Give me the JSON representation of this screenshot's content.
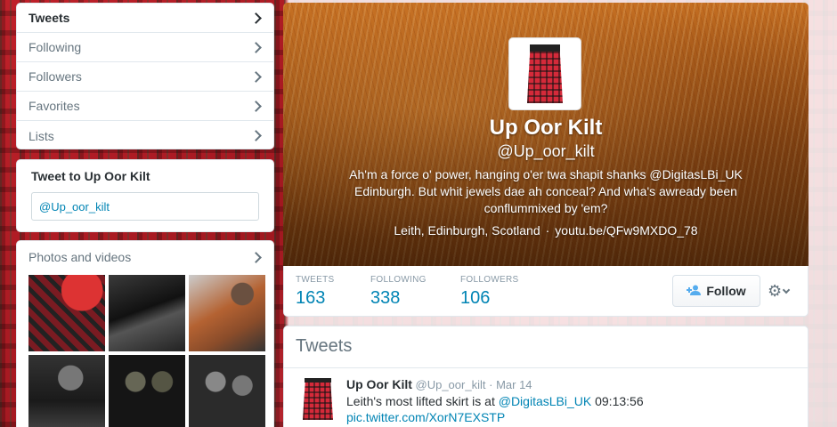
{
  "nav": {
    "items": [
      {
        "label": "Tweets",
        "active": true
      },
      {
        "label": "Following",
        "active": false
      },
      {
        "label": "Followers",
        "active": false
      },
      {
        "label": "Favorites",
        "active": false
      },
      {
        "label": "Lists",
        "active": false
      }
    ]
  },
  "tweet_to": {
    "title": "Tweet to Up Oor Kilt",
    "input_value": "@Up_oor_kilt"
  },
  "photos": {
    "title": "Photos and videos"
  },
  "profile": {
    "name": "Up Oor Kilt",
    "handle": "@Up_oor_kilt",
    "bio": "Ah'm a force o' power, hanging o'er twa shapit shanks @DigitasLBi_UK Edinburgh. But whit jewels dae ah conceal? And wha's awready been conflummixed by 'em?",
    "location": "Leith, Edinburgh, Scotland",
    "separator": "·",
    "website": "youtu.be/QFw9MXDO_78"
  },
  "stats": {
    "tweets_label": "TWEETS",
    "tweets_value": "163",
    "following_label": "FOLLOWING",
    "following_value": "338",
    "followers_label": "FOLLOWERS",
    "followers_value": "106"
  },
  "actions": {
    "follow_label": "Follow",
    "follow_icon": "add-user-icon",
    "gear_icon": "gear-icon"
  },
  "timeline": {
    "title": "Tweets",
    "tweet": {
      "name": "Up Oor Kilt",
      "handle": "@Up_oor_kilt",
      "dot": "·",
      "date": "Mar 14",
      "text_prefix": "Leith's most lifted skirt is at ",
      "mention": "@DigitasLBi_UK",
      "text_suffix": " 09:13:56",
      "link": "pic.twitter.com/XorN7EXSTP"
    }
  },
  "colors": {
    "link": "#0084b4",
    "tartan_red": "#d52a3a",
    "header_fur": "#c56f22"
  }
}
